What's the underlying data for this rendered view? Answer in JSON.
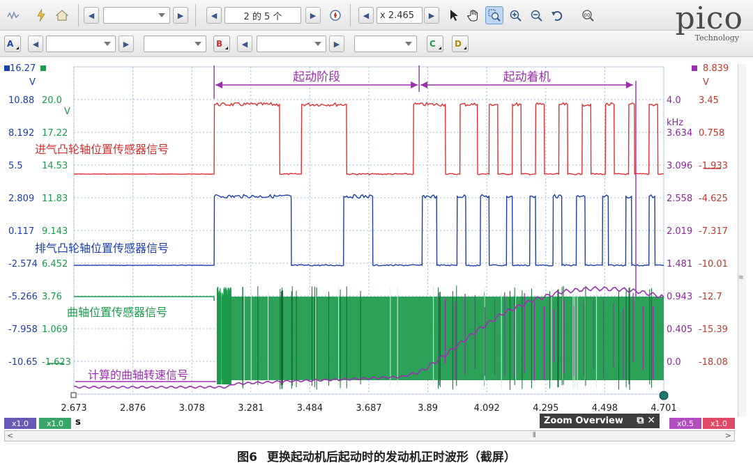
{
  "toolbar": {
    "page_label": "2 的 5 个",
    "zoom_label": "x 2.465",
    "channel_buttons": [
      "A",
      "B",
      "C",
      "D"
    ]
  },
  "logo": {
    "word": "pico",
    "sub": "Technology"
  },
  "axes": {
    "corner_left_value": "16.27",
    "corner_left_unit": "V",
    "corner_right_value": "8.839",
    "corner_right_unit": "V",
    "green_unit": "V",
    "khz_unit": "kHz",
    "blue_ticks": [
      "10.88",
      "8.192",
      "5.5",
      "2.809",
      "0.117",
      "-2.574",
      "-5.266",
      "-7.958",
      "-10.65"
    ],
    "green_ticks": [
      "20.0",
      "17.22",
      "14.53",
      "11.83",
      "9.143",
      "6.452",
      "3.76",
      "1.069",
      "-1.623"
    ],
    "khz_ticks": [
      "4.0",
      "3.634",
      "3.096",
      "2.558",
      "2.019",
      "1.481",
      "0.943",
      "0.405",
      "0.0"
    ],
    "red_ticks": [
      "3.45",
      "0.758",
      "-1.933",
      "-4.625",
      "-7.317",
      "-10.01",
      "-12.7",
      "-15.39",
      "-18.08"
    ],
    "x_ticks": [
      "2.673",
      "2.876",
      "3.078",
      "3.281",
      "3.484",
      "3.687",
      "3.89",
      "4.092",
      "4.295",
      "4.498",
      "4.701"
    ],
    "x_unit": "s"
  },
  "annotations": {
    "phase1": "起动阶段",
    "phase2": "起动着机",
    "intake": "进气凸轮轴位置传感器信号",
    "exhaust": "排气凸轮轴位置传感器信号",
    "crank": "曲轴位置传感器信号",
    "rpm": "计算的曲轴转速信号"
  },
  "bottom": {
    "mult_left1": "x1.0",
    "mult_left2": "x1.0",
    "mult_right1": "x0.5",
    "mult_right2": "x1.0",
    "zoom_overview": "Zoom Overview"
  },
  "caption": {
    "fig": "图6",
    "text": "更换起动机后起动时的发动机正时波形（截屏）"
  },
  "colors": {
    "red": "#e03030",
    "blue": "#1c3fa8",
    "green": "#1a9a4a",
    "purple": "#9b2fb0",
    "khz": "#8a2a9a",
    "grid": "#9bb7d4"
  },
  "chart_data": {
    "type": "line",
    "x_range": [
      2.673,
      4.701
    ],
    "xlabel": "s",
    "series": [
      {
        "name": "进气凸轮轴位置传感器信号",
        "kind": "square",
        "color": "red",
        "x": [
          2.673,
          3.155,
          3.156,
          3.38,
          3.381,
          3.455,
          3.456,
          3.61,
          3.611,
          3.84,
          3.841,
          3.95,
          3.951,
          4.0,
          4.001,
          4.06,
          4.061,
          4.1,
          4.101,
          4.13,
          4.131,
          4.18,
          4.181,
          4.21,
          4.211,
          4.26,
          4.261,
          4.29,
          4.291,
          4.34,
          4.341,
          4.37,
          4.371,
          4.42,
          4.421,
          4.45,
          4.451,
          4.5,
          4.501,
          4.53,
          4.531,
          4.58,
          4.581,
          4.6,
          4.601,
          4.65,
          4.651,
          4.68,
          4.681,
          4.701
        ],
        "y": [
          "low",
          "low",
          "high",
          "high",
          "low",
          "low",
          "high",
          "high",
          "low",
          "low",
          "high",
          "high",
          "low",
          "low",
          "high",
          "high",
          "low",
          "low",
          "high",
          "high",
          "low",
          "low",
          "high",
          "high",
          "low",
          "low",
          "high",
          "high",
          "low",
          "low",
          "high",
          "high",
          "low",
          "low",
          "high",
          "high",
          "low",
          "low",
          "high",
          "high",
          "low",
          "low",
          "high",
          "high",
          "low",
          "low",
          "high",
          "high",
          "low",
          "low"
        ]
      },
      {
        "name": "排气凸轮轴位置传感器信号",
        "kind": "square",
        "color": "blue",
        "x": [
          2.673,
          3.155,
          3.156,
          3.42,
          3.421,
          3.6,
          3.601,
          3.7,
          3.701,
          3.87,
          3.871,
          3.92,
          3.921,
          3.99,
          3.991,
          4.02,
          4.021,
          4.07,
          4.071,
          4.1,
          4.101,
          4.16,
          4.161,
          4.18,
          4.181,
          4.24,
          4.241,
          4.26,
          4.261,
          4.32,
          4.321,
          4.35,
          4.351,
          4.4,
          4.401,
          4.43,
          4.431,
          4.49,
          4.491,
          4.51,
          4.511,
          4.57,
          4.571,
          4.59,
          4.591,
          4.65,
          4.651,
          4.67,
          4.671,
          4.701
        ],
        "y": [
          "low",
          "low",
          "high",
          "high",
          "low",
          "low",
          "high",
          "high",
          "low",
          "low",
          "high",
          "high",
          "low",
          "low",
          "high",
          "high",
          "low",
          "low",
          "high",
          "high",
          "low",
          "low",
          "high",
          "high",
          "low",
          "low",
          "high",
          "high",
          "low",
          "low",
          "high",
          "high",
          "low",
          "low",
          "high",
          "high",
          "low",
          "low",
          "high",
          "high",
          "low",
          "low",
          "high",
          "high",
          "low",
          "low",
          "high",
          "high",
          "low",
          "low"
        ]
      },
      {
        "name": "曲轴位置传感器信号",
        "kind": "dense",
        "color": "green",
        "x": [
          2.673,
          3.155,
          4.701
        ]
      },
      {
        "name": "计算的曲轴转速信号",
        "kind": "curve",
        "color": "purple",
        "unit": "kHz",
        "x": [
          2.673,
          3.2,
          3.22,
          3.4,
          3.6,
          3.8,
          3.87,
          3.95,
          4.05,
          4.15,
          4.25,
          4.35,
          4.45,
          4.55,
          4.62,
          4.701
        ],
        "y": [
          0.0,
          0.0,
          0.05,
          0.09,
          0.12,
          0.16,
          0.25,
          0.5,
          0.85,
          1.15,
          1.35,
          1.48,
          1.53,
          1.52,
          1.48,
          1.4
        ]
      }
    ]
  }
}
